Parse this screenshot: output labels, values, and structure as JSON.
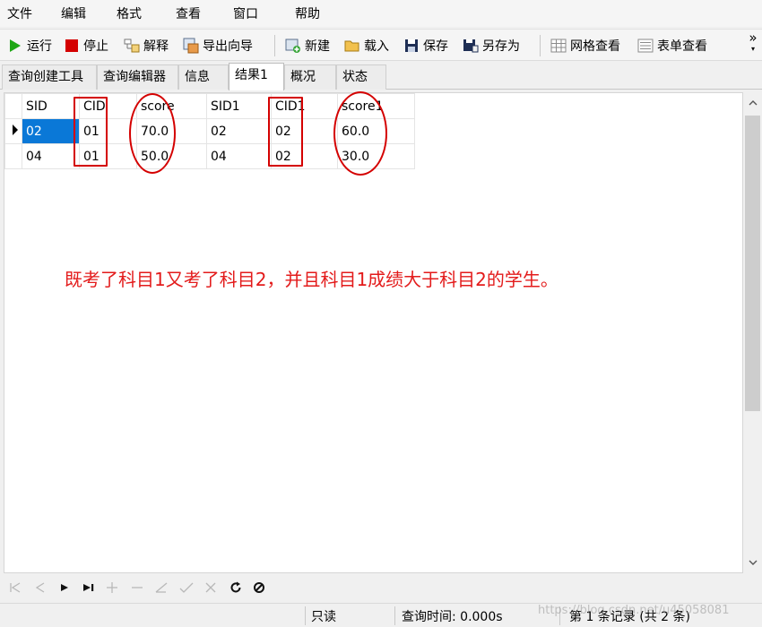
{
  "menu": [
    "文件",
    "编辑",
    "格式",
    "查看",
    "窗口",
    "帮助"
  ],
  "toolbar": {
    "run": "运行",
    "stop": "停止",
    "explain": "解释",
    "export_wizard": "导出向导",
    "new": "新建",
    "load": "载入",
    "save": "保存",
    "save_as": "另存为",
    "grid_view": "网格查看",
    "form_view": "表单查看",
    "more": "»"
  },
  "tabs": [
    "查询创建工具",
    "查询编辑器",
    "信息",
    "结果1",
    "概况",
    "状态"
  ],
  "active_tab": "结果1",
  "grid": {
    "columns": [
      "SID",
      "CID",
      "score",
      "SID1",
      "CID1",
      "score1"
    ],
    "rows": [
      [
        "02",
        "01",
        "70.0",
        "02",
        "02",
        "60.0"
      ],
      [
        "04",
        "01",
        "50.0",
        "04",
        "02",
        "30.0"
      ]
    ]
  },
  "annotation": {
    "text": "既考了科目1又考了科目2，并且科目1成绩大于科目2的学生。",
    "color": "#e31b1b"
  },
  "status": {
    "readonly": "只读",
    "query_time": "查询时间: 0.000s",
    "record": "第 1 条记录 (共 2 条)"
  },
  "watermark": "https://blog.csdn.net/u45058081",
  "colors": {
    "selection": "#0a78d7",
    "run_icon": "#1ea614",
    "stop_icon": "#d40000",
    "annotation_stroke": "#d40000"
  }
}
